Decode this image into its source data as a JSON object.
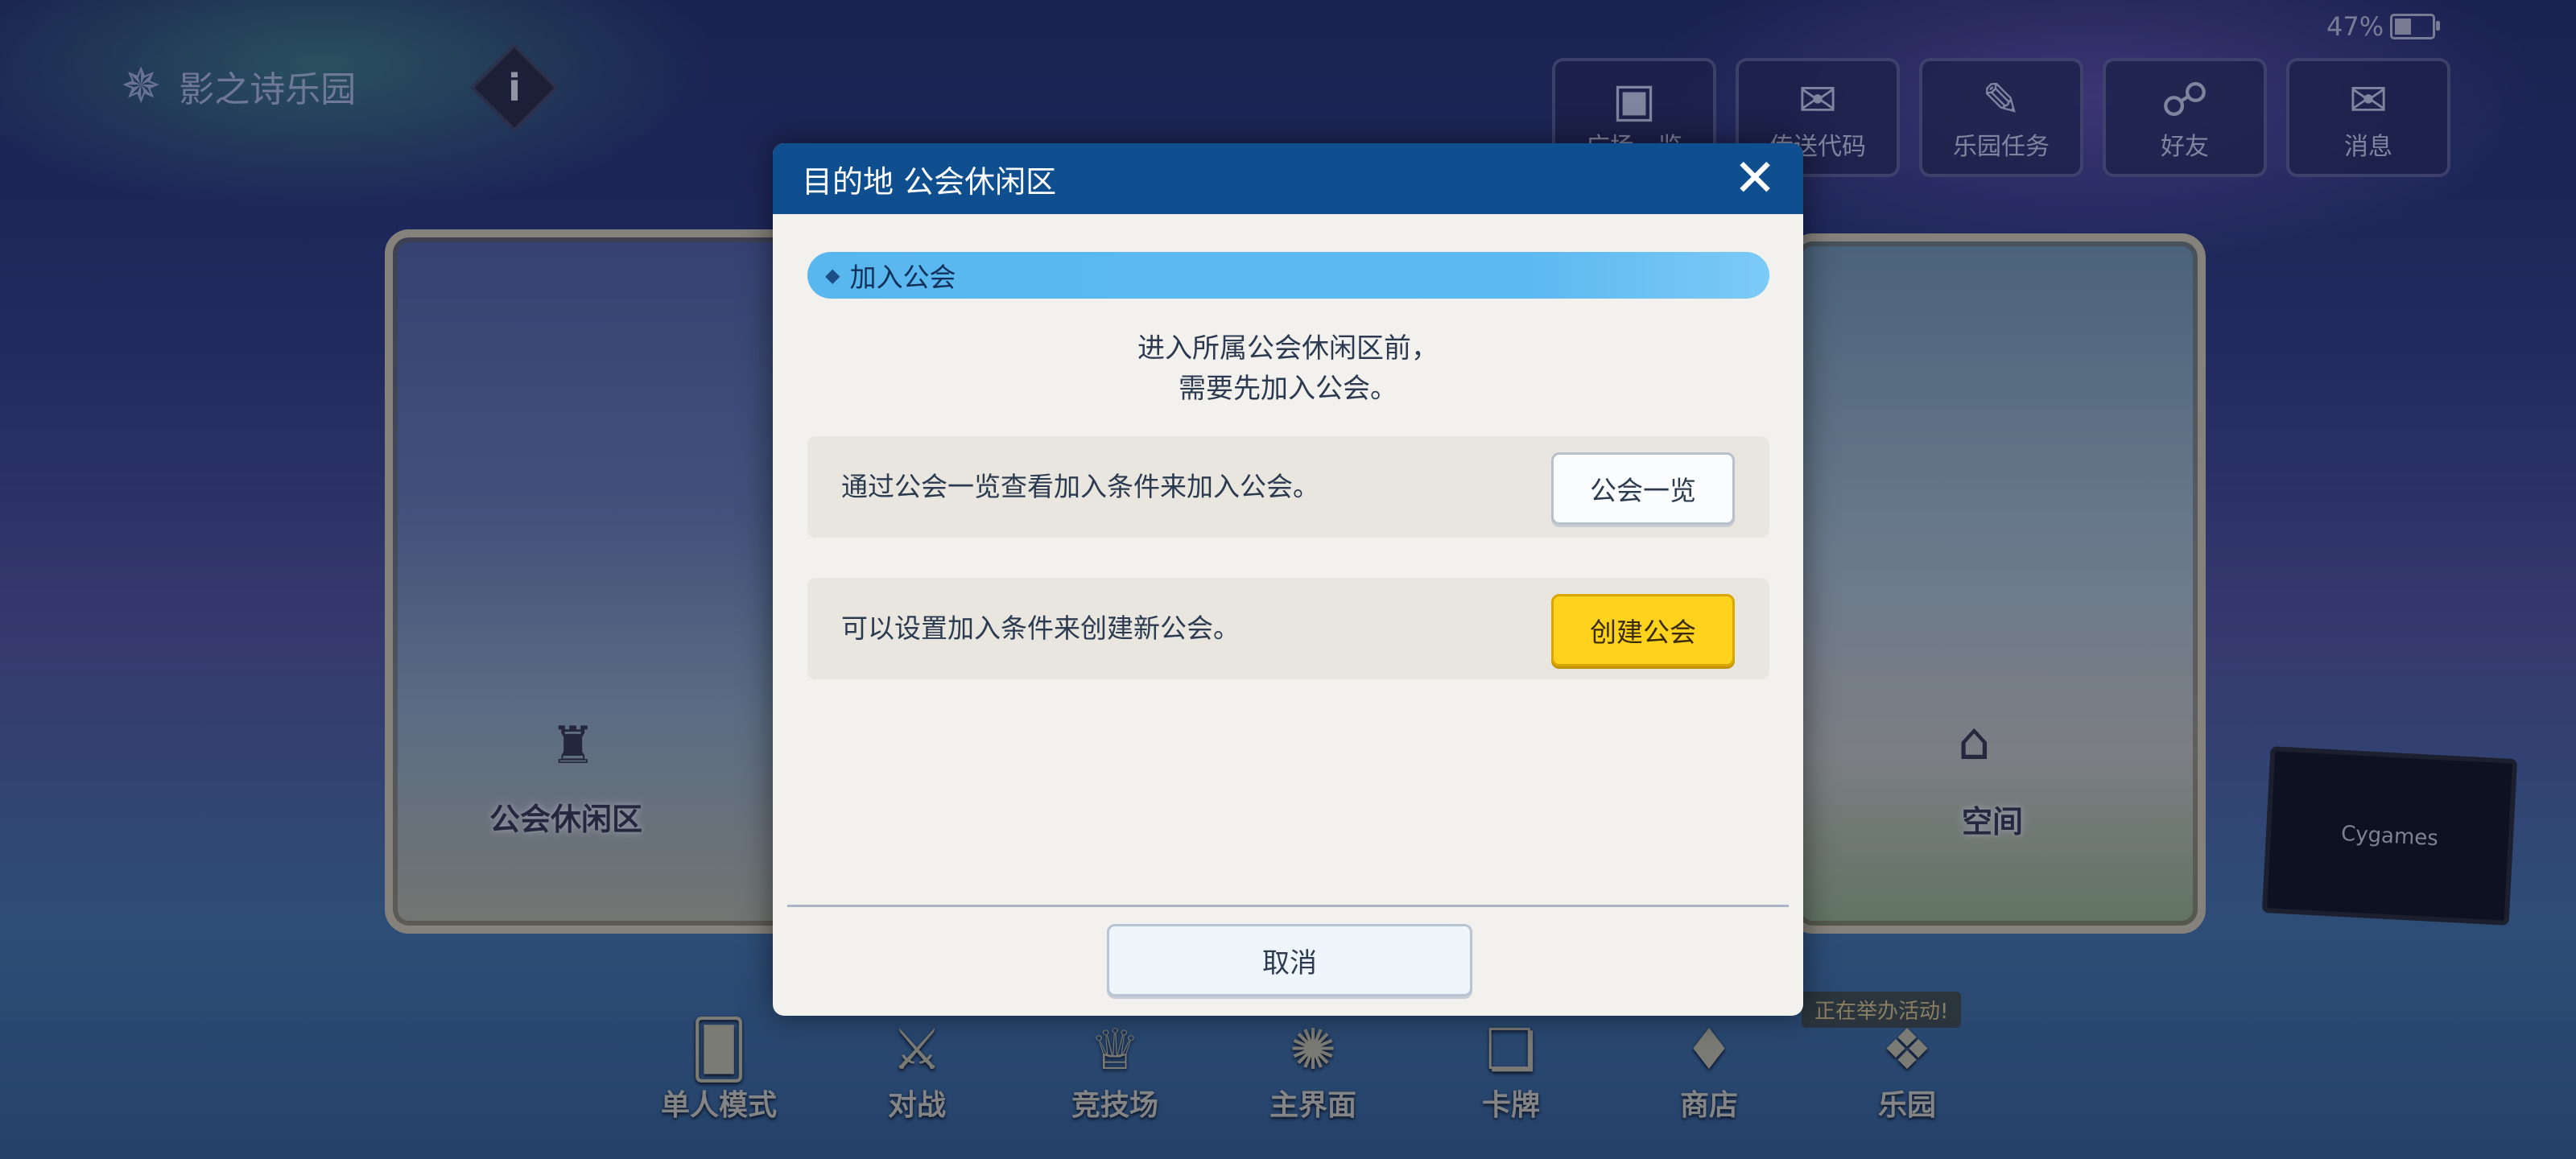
{
  "venue": {
    "name": "影之诗乐园"
  },
  "status": {
    "battery": "47%",
    "battery_level": 0.47
  },
  "top_menu": [
    {
      "label": "广场一览",
      "icon": "map-icon"
    },
    {
      "label": "传送代码",
      "icon": "envelope-pin-icon"
    },
    {
      "label": "乐园任务",
      "icon": "quest-icon"
    },
    {
      "label": "好友",
      "icon": "handshake-icon"
    },
    {
      "label": "消息",
      "icon": "message-icon"
    }
  ],
  "cards": {
    "left_label": "公会休闲区",
    "right_label": "空间",
    "screen_text": "Cygames",
    "notice": "正在举办活动!"
  },
  "dialog": {
    "title": "目的地 公会休闲区",
    "section": "加入公会",
    "intro_line1": "进入所属公会休闲区前，",
    "intro_line2": "需要先加入公会。",
    "row1_text": "通过公会一览查看加入条件来加入公会。",
    "row1_button": "公会一览",
    "row2_text": "可以设置加入条件来创建新公会。",
    "row2_button": "创建公会",
    "cancel": "取消"
  },
  "bottom_nav": [
    {
      "label": "单人模式",
      "icon": "solo-cards-icon"
    },
    {
      "label": "对战",
      "icon": "crossed-swords-icon"
    },
    {
      "label": "竞技场",
      "icon": "trophy-icon"
    },
    {
      "label": "主界面",
      "icon": "compass-emblem-icon"
    },
    {
      "label": "卡牌",
      "icon": "cards-icon"
    },
    {
      "label": "商店",
      "icon": "shop-icon"
    },
    {
      "label": "乐园",
      "icon": "park-icon"
    }
  ]
}
